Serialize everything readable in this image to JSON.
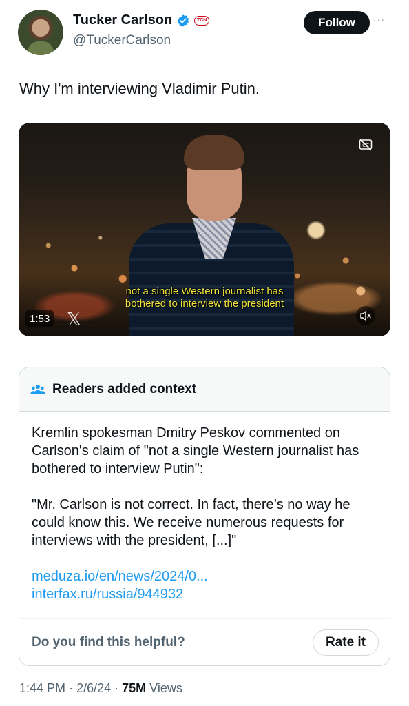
{
  "author": {
    "name": "Tucker Carlson",
    "handle": "@TuckerCarlson",
    "affiliate_badge": "TCN",
    "follow_label": "Follow",
    "more_label": "···"
  },
  "tweet": {
    "text": "Why I'm interviewing Vladimir Putin."
  },
  "video": {
    "subtitle_line1": "not a single Western journalist has",
    "subtitle_line2": "bothered to interview the president",
    "timestamp": "1:53",
    "watermark": "𝕏",
    "icons": [
      "captions-icon",
      "mute-icon"
    ]
  },
  "community_note": {
    "title": "Readers added context",
    "paragraph1": "Kremlin spokesman Dmitry Peskov commented on Carlson's claim of \"not a single Western journalist has bothered to interview Putin\":",
    "paragraph2": "\"Mr. Carlson is not correct. In fact, there’s no way he could know this. We receive numerous requests for interviews with the president, [...]\"",
    "link1": "meduza.io/en/news/2024/0...",
    "link2": "interfax.ru/russia/944932",
    "helpful_question": "Do you find this helpful?",
    "rate_label": "Rate it"
  },
  "meta": {
    "time": "1:44 PM",
    "date": "2/6/24",
    "views_count": "75M",
    "views_label": "Views"
  },
  "colors": {
    "accent": "#1d9bf0",
    "text": "#0f1419",
    "muted": "#536471",
    "subtitle": "#f0e23a"
  }
}
